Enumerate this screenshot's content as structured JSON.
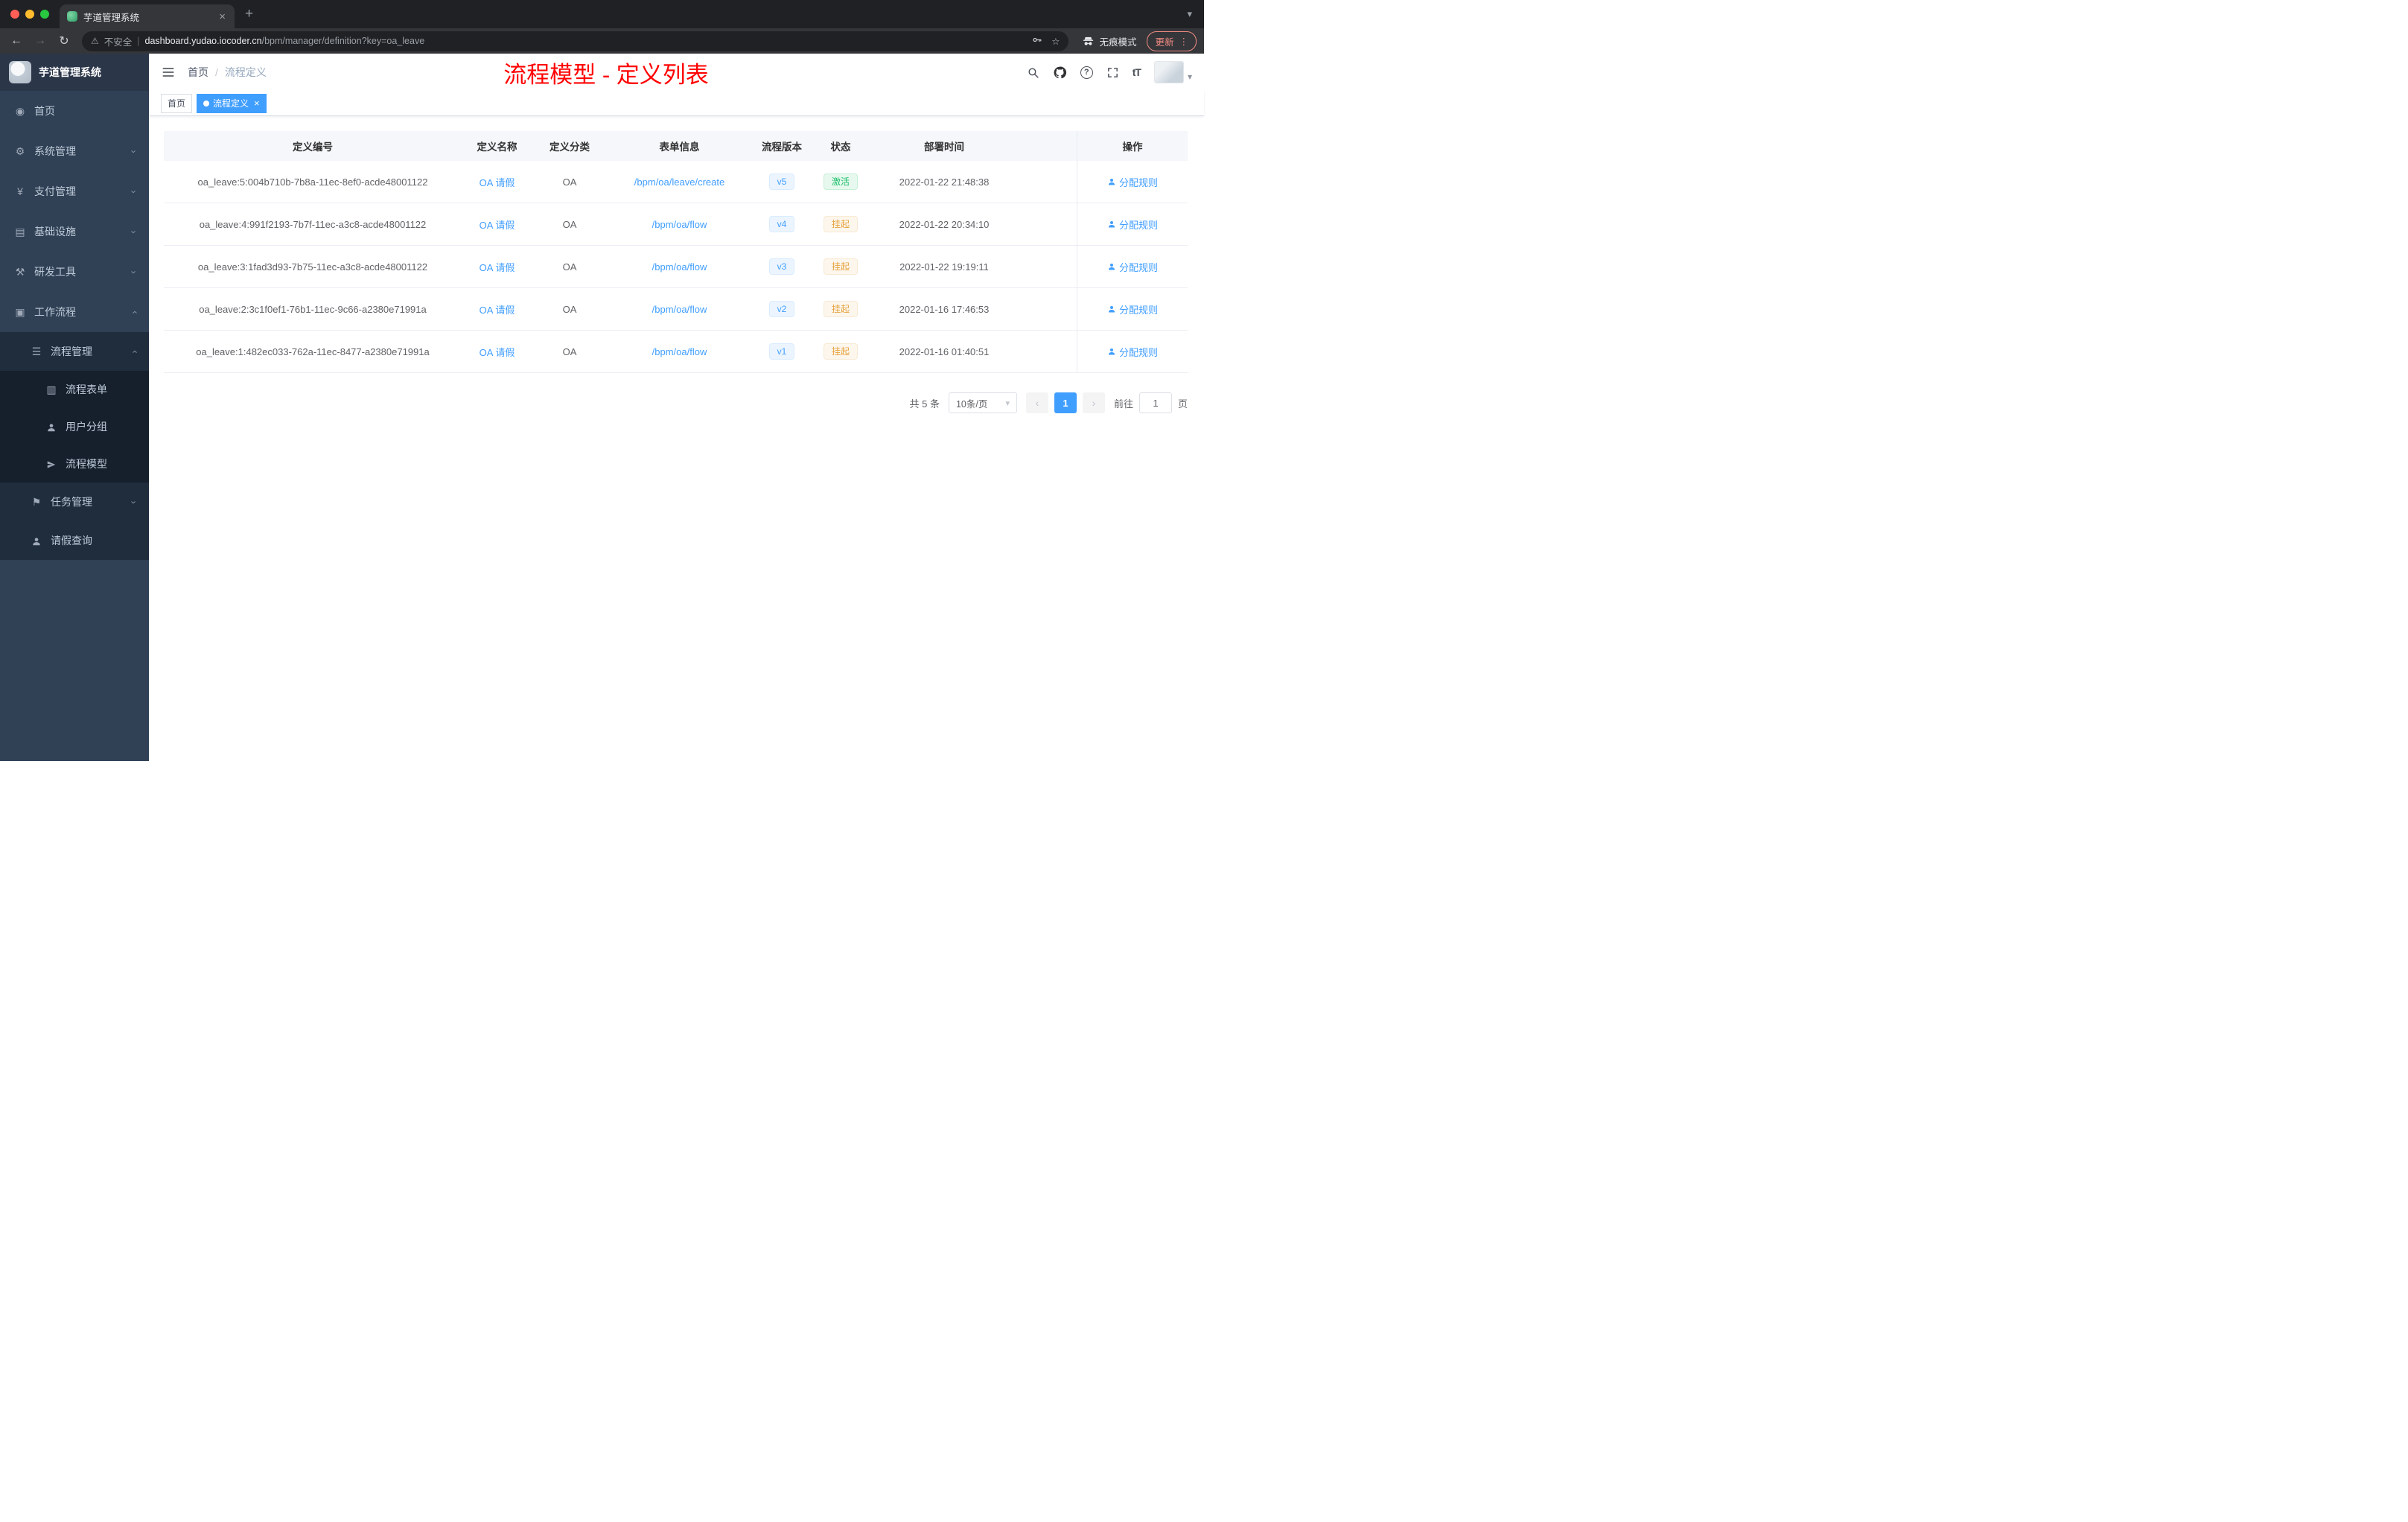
{
  "browser": {
    "tab_title": "芋道管理系统",
    "security_label": "不安全",
    "url_domain": "dashboard.yudao.iocoder.cn",
    "url_path": "/bpm/manager/definition?key=oa_leave",
    "incognito_label": "无痕模式",
    "update_label": "更新"
  },
  "icons": {
    "close": "×",
    "new_tab": "+",
    "back": "←",
    "forward": "→",
    "reload": "↻",
    "warning": "⚠",
    "star": "☆",
    "more": "⋮",
    "caret_down": "▾",
    "chevron": "›",
    "prev": "‹",
    "next": "›",
    "home": "◉",
    "gear": "⚙",
    "yen": "¥",
    "infra": "▤",
    "tools": "⚒",
    "workflow": "▣",
    "list": "☰",
    "form": "▥",
    "flag": "⚑",
    "font_size": "tT",
    "help": "?",
    "separator": "|"
  },
  "sidebar": {
    "logo_title": "芋道管理系统",
    "items": [
      {
        "label": "首页"
      },
      {
        "label": "系统管理"
      },
      {
        "label": "支付管理"
      },
      {
        "label": "基础设施"
      },
      {
        "label": "研发工具"
      },
      {
        "label": "工作流程"
      },
      {
        "label": "流程管理"
      },
      {
        "label": "流程表单"
      },
      {
        "label": "用户分组"
      },
      {
        "label": "流程模型"
      },
      {
        "label": "任务管理"
      },
      {
        "label": "请假查询"
      }
    ]
  },
  "header": {
    "breadcrumb_home": "首页",
    "breadcrumb_separator": "/",
    "breadcrumb_current": "流程定义",
    "annotation": "流程模型 - 定义列表"
  },
  "tags": {
    "items": [
      {
        "label": "首页"
      },
      {
        "label": "流程定义"
      }
    ]
  },
  "table": {
    "columns": [
      "定义编号",
      "定义名称",
      "定义分类",
      "表单信息",
      "流程版本",
      "状态",
      "部署时间",
      "操作"
    ],
    "rows": [
      {
        "id": "oa_leave:5:004b710b-7b8a-11ec-8ef0-acde48001122",
        "name": "OA 请假",
        "category": "OA",
        "form": "/bpm/oa/leave/create",
        "version": "v5",
        "status": "激活",
        "time": "2022-01-22 21:48:38",
        "action": "分配规则"
      },
      {
        "id": "oa_leave:4:991f2193-7b7f-11ec-a3c8-acde48001122",
        "name": "OA 请假",
        "category": "OA",
        "form": "/bpm/oa/flow",
        "version": "v4",
        "status": "挂起",
        "time": "2022-01-22 20:34:10",
        "action": "分配规则"
      },
      {
        "id": "oa_leave:3:1fad3d93-7b75-11ec-a3c8-acde48001122",
        "name": "OA 请假",
        "category": "OA",
        "form": "/bpm/oa/flow",
        "version": "v3",
        "status": "挂起",
        "time": "2022-01-22 19:19:11",
        "action": "分配规则"
      },
      {
        "id": "oa_leave:2:3c1f0ef1-76b1-11ec-9c66-a2380e71991a",
        "name": "OA 请假",
        "category": "OA",
        "form": "/bpm/oa/flow",
        "version": "v2",
        "status": "挂起",
        "time": "2022-01-16 17:46:53",
        "action": "分配规则"
      },
      {
        "id": "oa_leave:1:482ec033-762a-11ec-8477-a2380e71991a",
        "name": "OA 请假",
        "category": "OA",
        "form": "/bpm/oa/flow",
        "version": "v1",
        "status": "挂起",
        "time": "2022-01-16 01:40:51",
        "action": "分配规则"
      }
    ]
  },
  "pagination": {
    "total": "共 5 条",
    "page_size": "10条/页",
    "current_page": "1",
    "goto_label": "前往",
    "goto_value": "1",
    "page_unit": "页"
  },
  "colors": {
    "accent": "#409eff",
    "success": "#1cbe6b",
    "warning": "#e6a23c",
    "annotation_red": "#ff0000",
    "sidebar_bg": "#304156",
    "submenu_bg": "#1f2d3d"
  }
}
